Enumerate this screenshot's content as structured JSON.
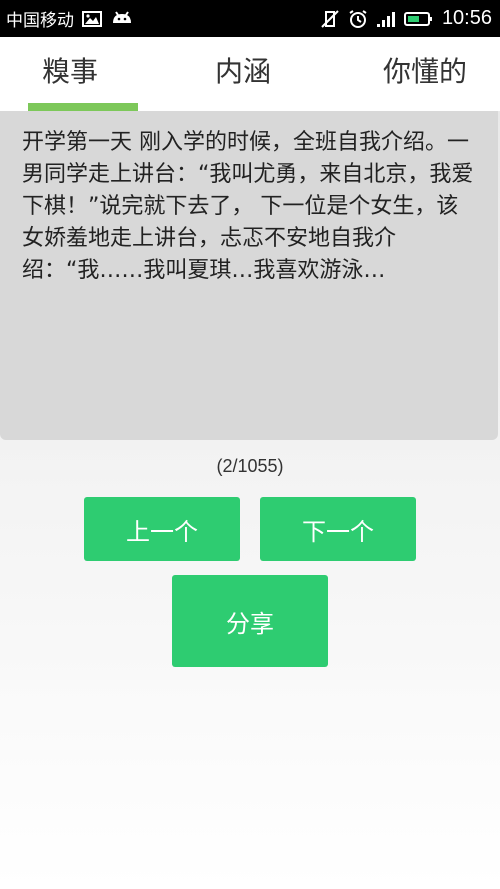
{
  "status_bar": {
    "carrier": "中国移动",
    "time": "10:56"
  },
  "tabs": [
    {
      "label": "糗事",
      "active": true
    },
    {
      "label": "内涵",
      "active": false
    },
    {
      "label": "你懂的",
      "active": false
    }
  ],
  "colors": {
    "accent": "#2ecc71",
    "tab_indicator": "#7dc85a"
  },
  "content": {
    "text": "开学第一天 刚入学的时候，全班自我介绍。一男同学走上讲台：“我叫尤勇，来自北京，我爱下棋！”说完就下去了， 下一位是个女生，该女娇羞地走上讲台，忐忑不安地自我介绍：“我……我叫夏琪…我喜欢游泳…"
  },
  "counter": "(2/1055)",
  "buttons": {
    "prev_label": "上一个",
    "next_label": "下一个",
    "share_label": "分享"
  }
}
